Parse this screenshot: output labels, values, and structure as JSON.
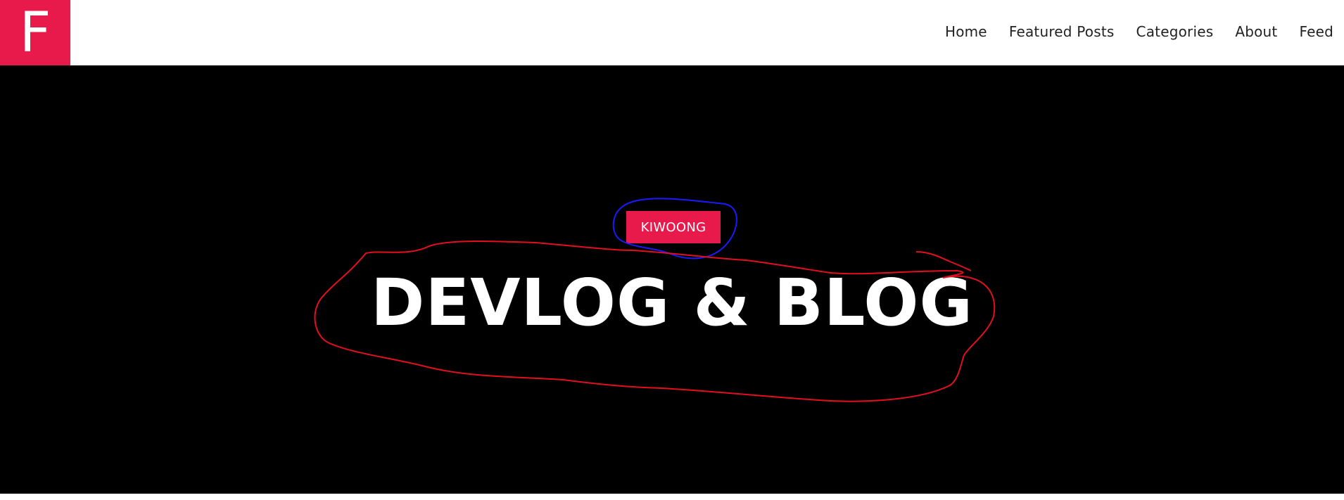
{
  "header": {
    "logo_letter": "F",
    "nav": [
      {
        "label": "Home"
      },
      {
        "label": "Featured Posts"
      },
      {
        "label": "Categories"
      },
      {
        "label": "About"
      },
      {
        "label": "Feed"
      }
    ]
  },
  "hero": {
    "badge": "KIWOONG",
    "title": "DEVLOG & BLOG"
  },
  "colors": {
    "accent": "#e8194b",
    "hero_background": "#000000",
    "annotation_red": "#e0101e",
    "annotation_blue": "#1a1aff"
  }
}
